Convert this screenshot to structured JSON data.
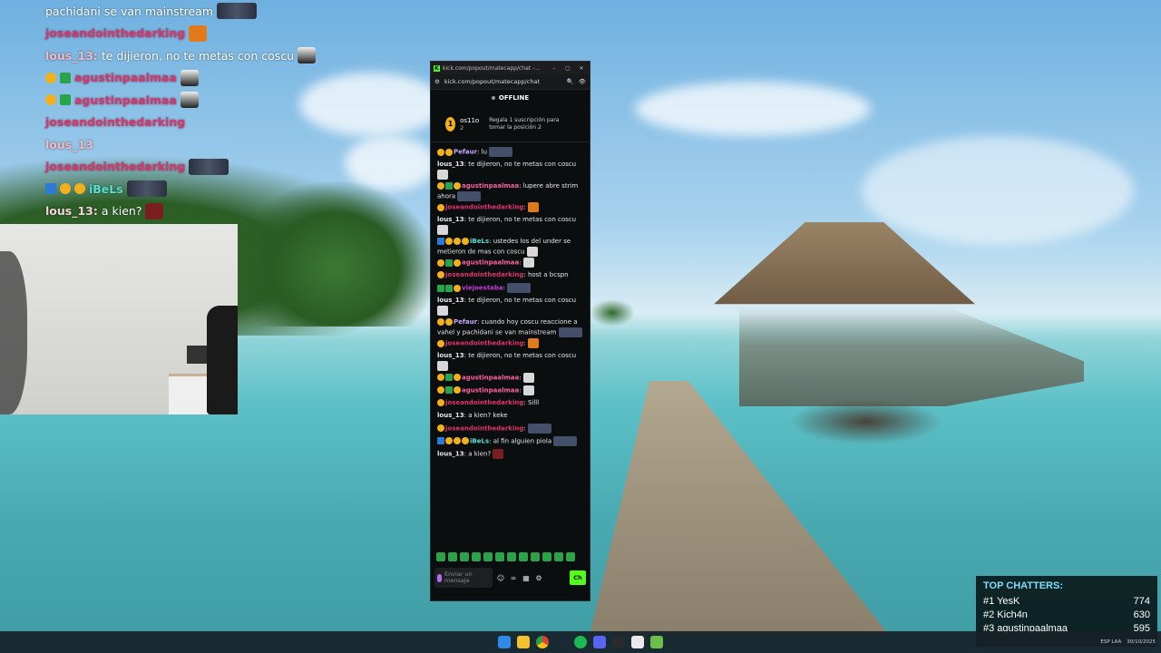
{
  "overlay_chat": [
    {
      "user": "",
      "text": "pachidani se van mainstream",
      "user_color": "#ffffff",
      "badges": [],
      "emotes": [
        "w"
      ]
    },
    {
      "user": "joseandointhedarking",
      "text": "",
      "user_color": "#e0336d",
      "badges": [],
      "emotes": [
        "orange"
      ]
    },
    {
      "user": "lous_13:",
      "text": "te dijieron, no te metas con coscu",
      "user_color": "#f3b8c4",
      "badges": [],
      "emotes": [
        "face"
      ]
    },
    {
      "user": "agustinpaalmaa",
      "text": "",
      "user_color": "#e0336d",
      "badges": [
        "y",
        "g"
      ],
      "emotes": [
        "face"
      ]
    },
    {
      "user": "agustinpaalmaa",
      "text": "",
      "user_color": "#e0336d",
      "badges": [
        "y",
        "g"
      ],
      "emotes": [
        "face"
      ]
    },
    {
      "user": "joseandointhedarking",
      "text": "",
      "user_color": "#e0336d",
      "badges": [],
      "emotes": []
    },
    {
      "user": "lous_13",
      "text": "",
      "user_color": "#f3b8c4",
      "badges": [],
      "emotes": []
    },
    {
      "user": "joseandointhedarking",
      "text": "",
      "user_color": "#e0336d",
      "badges": [],
      "emotes": [
        "w"
      ]
    },
    {
      "user": "iBeLs",
      "text": "",
      "user_color": "#56e0d0",
      "badges": [
        "b",
        "y",
        "y"
      ],
      "emotes": [
        "w"
      ]
    },
    {
      "user": "lous_13:",
      "text": "a kien?",
      "user_color": "#f3d3da",
      "badges": [],
      "emotes": [
        "red"
      ]
    }
  ],
  "popout": {
    "window_title": "kick.com/popout/matecapp/chat -...",
    "url": "kick.com/popout/matecapp/chat",
    "status": "OFFLINE",
    "sub_user": "os11o",
    "sub_count": "2",
    "sub_rank": "1",
    "sub_info": "Regala 1 suscripción para tomar la posición 2",
    "input_placeholder": "Enviar un mensaje",
    "send_label": "Ch",
    "messages": [
      {
        "badges": [
          "y",
          "y"
        ],
        "user": "Pefaur",
        "user_color": "#c9a8ff",
        "text": " lu",
        "emote": "w"
      },
      {
        "badges": [],
        "user": "lous_13",
        "user_color": "#e8e8e8",
        "text": " te dijieron, no te metas con coscu",
        "emote": "face"
      },
      {
        "badges": [
          "y",
          "g",
          "y"
        ],
        "user": "agustinpaalmaa",
        "user_color": "#ff5fa0",
        "text": " lupere abre strim ahora",
        "emote": "w"
      },
      {
        "badges": [
          "y"
        ],
        "user": "joseandointhedarking",
        "user_color": "#e0336d",
        "text": "",
        "emote": "o"
      },
      {
        "badges": [],
        "user": "lous_13",
        "user_color": "#e8e8e8",
        "text": " te dijieron, no te metas con coscu",
        "emote": "face"
      },
      {
        "badges": [
          "b",
          "y",
          "y",
          "y"
        ],
        "user": "iBeLs",
        "user_color": "#56e0d0",
        "text": " ustedes los del under se metieron de mas con coscu",
        "emote": "face"
      },
      {
        "badges": [
          "y",
          "g",
          "y"
        ],
        "user": "agustinpaalmaa",
        "user_color": "#ff5fa0",
        "text": "",
        "emote": "face"
      },
      {
        "badges": [
          "y"
        ],
        "user": "joseandointhedarking",
        "user_color": "#e0336d",
        "text": " host a bcspn",
        "emote": ""
      },
      {
        "badges": [
          "g",
          "g",
          "y"
        ],
        "user": "viejoestaba",
        "user_color": "#c13bd6",
        "text": "",
        "emote": "w"
      },
      {
        "badges": [],
        "user": "lous_13",
        "user_color": "#e8e8e8",
        "text": " te dijieron, no te metas con coscu",
        "emote": "face"
      },
      {
        "badges": [
          "y",
          "y"
        ],
        "user": "Pefaur",
        "user_color": "#c9a8ff",
        "text": " cuando hoy coscu reaccione a vahel y pachidani se van mainstream",
        "emote": "w"
      },
      {
        "badges": [
          "y"
        ],
        "user": "joseandointhedarking",
        "user_color": "#e0336d",
        "text": "",
        "emote": "o"
      },
      {
        "badges": [],
        "user": "lous_13",
        "user_color": "#e8e8e8",
        "text": " te dijieron, no te metas con coscu",
        "emote": "face"
      },
      {
        "badges": [
          "y",
          "g",
          "y"
        ],
        "user": "agustinpaalmaa",
        "user_color": "#ff5fa0",
        "text": "",
        "emote": "face"
      },
      {
        "badges": [
          "y",
          "g",
          "y"
        ],
        "user": "agustinpaalmaa",
        "user_color": "#ff5fa0",
        "text": "",
        "emote": "face"
      },
      {
        "badges": [
          "y"
        ],
        "user": "joseandointhedarking",
        "user_color": "#e0336d",
        "text": " Silll",
        "emote": ""
      },
      {
        "badges": [],
        "user": "lous_13",
        "user_color": "#e8e8e8",
        "text": " a kien? keke",
        "emote": ""
      },
      {
        "badges": [
          "y"
        ],
        "user": "joseandointhedarking",
        "user_color": "#e0336d",
        "text": "",
        "emote": "w"
      },
      {
        "badges": [
          "b",
          "y",
          "y",
          "y"
        ],
        "user": "iBeLs",
        "user_color": "#56e0d0",
        "text": " al fin alguien piola",
        "emote": "w"
      },
      {
        "badges": [],
        "user": "lous_13",
        "user_color": "#e8e8e8",
        "text": " a kien?",
        "emote": "r"
      }
    ]
  },
  "top_chatters": {
    "title": "TOP CHATTERS:",
    "entries": [
      {
        "rank": "#1",
        "name": "YesK",
        "count": "774"
      },
      {
        "rank": "#2",
        "name": "Kich4n",
        "count": "630"
      },
      {
        "rank": "#3",
        "name": "agustinpaalmaa",
        "count": "595"
      }
    ]
  },
  "taskbar": {
    "apps": [
      "windows-start",
      "file-explorer",
      "chrome",
      "steam",
      "spotify",
      "discord",
      "obs",
      "app-7",
      "app-8"
    ],
    "tray_lang": "ESP LAA",
    "tray_date": "30/10/2025"
  }
}
